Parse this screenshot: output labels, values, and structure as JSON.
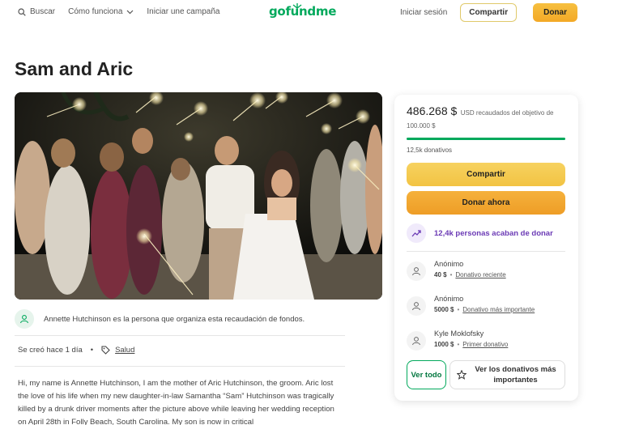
{
  "header": {
    "search_label": "Buscar",
    "how_it_works_label": "Cómo funciona",
    "start_campaign_label": "Iniciar une campaña",
    "logo_text": "gofundme",
    "login_label": "Iniciar sesión",
    "share_label": "Compartir",
    "donate_label": "Donar"
  },
  "campaign": {
    "title": "Sam and Aric",
    "organizer_text": "Annette Hutchinson es la persona que organiza esta recaudación de fondos.",
    "created_text": "Se creó hace 1 día",
    "category": "Salud",
    "story": "Hi, my name is Annette Hutchinson, I am the mother of Aric Hutchinson, the groom. Aric lost the love of his life when my new daughter-in-law Samantha “Sam” Hutchinson was tragically killed by a drunk driver moments after the picture above while leaving her wedding reception on April 28th in Folly Beach, South Carolina. My son is now in critical"
  },
  "sidebar": {
    "amount_raised": "486.268 $",
    "raised_of_goal": "USD recaudados del objetivo de 100.000 $",
    "progress_fraction": 1.0,
    "donations_count": "12,5k donativos",
    "share_button": "Compartir",
    "donate_button": "Donar ahora",
    "recent_donors": "12,4k personas acaban de donar",
    "donors": [
      {
        "name": "Anónimo",
        "amount": "40 $",
        "label": "Donativo reciente"
      },
      {
        "name": "Anónimo",
        "amount": "5000 $",
        "label": "Donativo más importante"
      },
      {
        "name": "Kyle Moklofsky",
        "amount": "1000 $",
        "label": "Primer donativo"
      }
    ],
    "see_all_button": "Ver todo",
    "see_top_button": "Ver los donativos más importantes"
  },
  "colors": {
    "brand_green": "#02a95c",
    "donate_orange": "#f3a926",
    "share_yellow": "#f2c343",
    "trend_purple": "#6b3ab5"
  }
}
